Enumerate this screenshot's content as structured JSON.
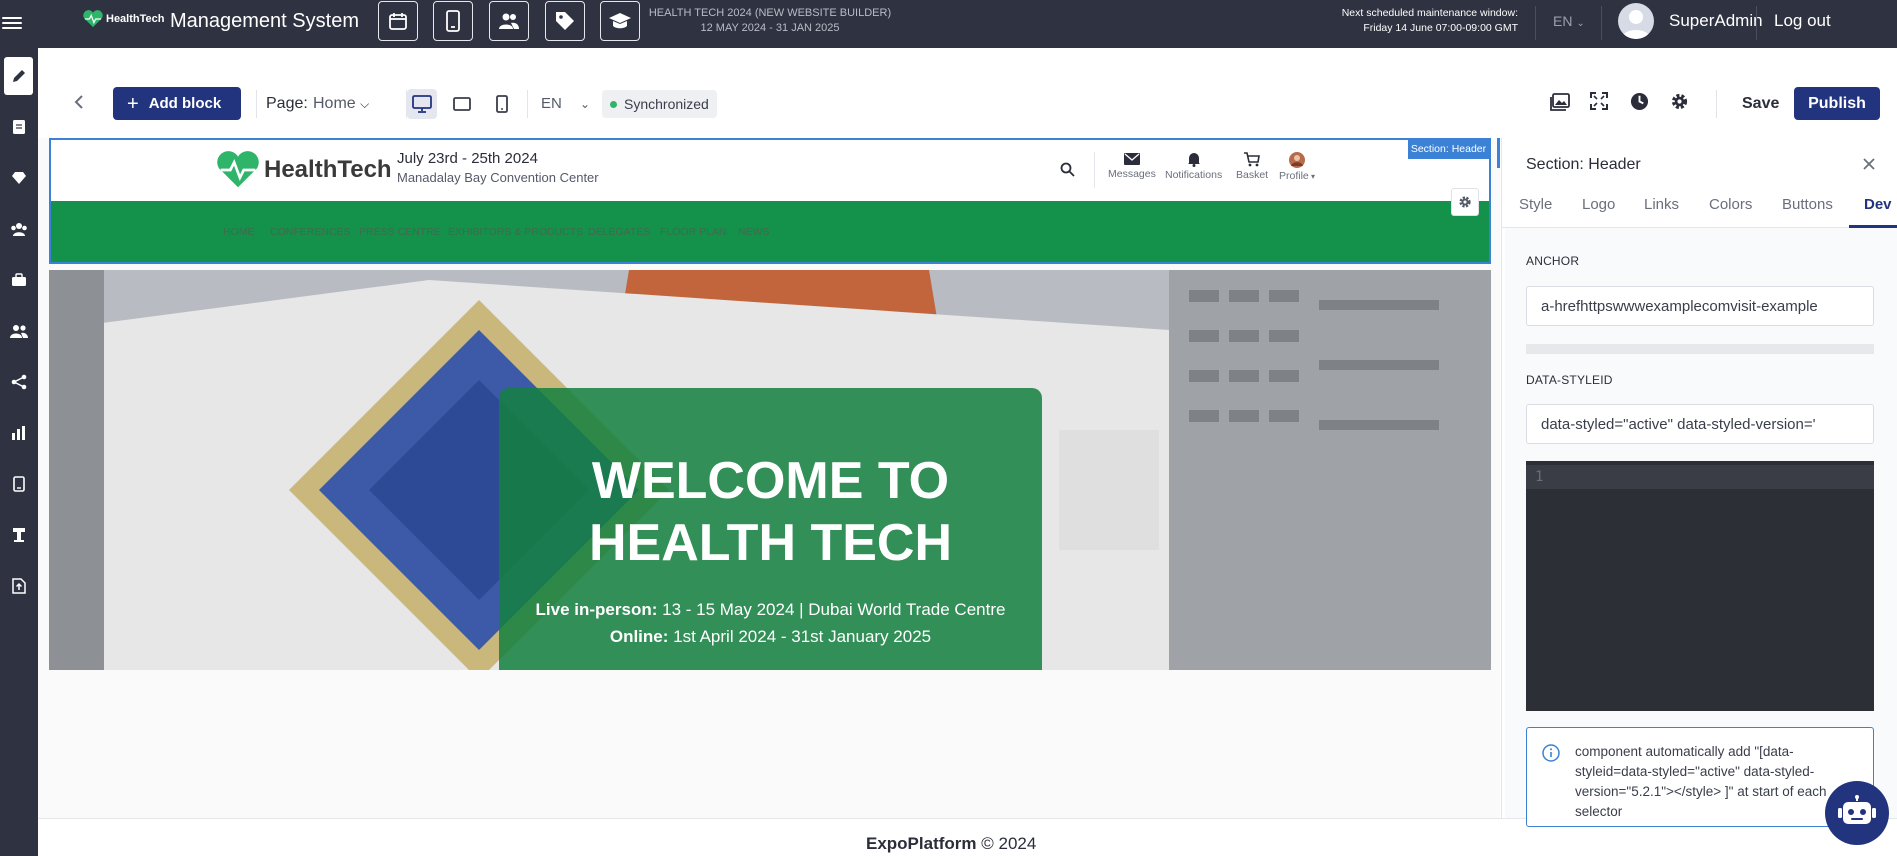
{
  "topbar": {
    "logo_text": "HealthTech",
    "title": "Management System",
    "event_name": "HEALTH TECH 2024 (NEW WEBSITE BUILDER)",
    "event_dates": "12 MAY 2024 - 31 JAN 2025",
    "maintenance_label": "Next scheduled maintenance window:",
    "maintenance_time": "Friday 14 June 07:00-09:00 GMT",
    "language": "EN",
    "user": "SuperAdmin",
    "logout": "Log out"
  },
  "toolbar": {
    "add_block": "Add block",
    "page_label": "Page:",
    "page_value": "Home",
    "language": "EN",
    "sync_status": "Synchronized",
    "save": "Save",
    "publish": "Publish"
  },
  "site_header": {
    "section_tag": "Section: Header",
    "logo_text": "HealthTech",
    "event_date": "July 23rd - 25th 2024",
    "venue": "Manadalay Bay Convention Center",
    "icons": [
      {
        "name": "Messages",
        "icon": "mail-icon"
      },
      {
        "name": "Notifications",
        "icon": "bell-icon"
      },
      {
        "name": "Basket",
        "icon": "cart-icon"
      },
      {
        "name": "Profile",
        "icon": "avatar-icon"
      }
    ],
    "nav": [
      "HOME",
      "CONFERENCES",
      "PRESS CENTRE",
      "EXHIBITORS & PRODUCTS",
      "DELEGATES",
      "FLOOR PLAN",
      "NEWS"
    ],
    "nav_color": "#14914a"
  },
  "hero": {
    "title_line1": "WELCOME TO",
    "title_line2": "HEALTH TECH",
    "live_label": "Live in-person:",
    "live_value": " 13  - 15 May 2024 | Dubai World Trade Centre",
    "online_label": "Online:",
    "online_value": " 1st April 2024 - 31st January 2025"
  },
  "footer": {
    "brand": "ExpoPlatform",
    "copyright": " © 2024"
  },
  "panel": {
    "title": "Section: Header",
    "tabs": [
      "Style",
      "Logo",
      "Links",
      "Colors",
      "Buttons",
      "Dev"
    ],
    "active_tab": "Dev",
    "anchor_label": "ANCHOR",
    "anchor_value": "a-hrefhttpswwwexamplecomvisit-example",
    "styleid_label": "DATA-STYLEID",
    "styleid_value": "data-styled=\"active\" data-styled-version='",
    "code_line_number": "1",
    "info_text": "component automatically add \"[data-styleid=data-styled=\"active\" data-styled-version=\"5.2.1\"></style> ]\" at start of each selector"
  },
  "colors": {
    "topbar": "#2f3240",
    "primary": "#23347f",
    "selection": "#3b82d6",
    "nav_green": "#14914a",
    "sync_dot": "#2fb56a"
  }
}
